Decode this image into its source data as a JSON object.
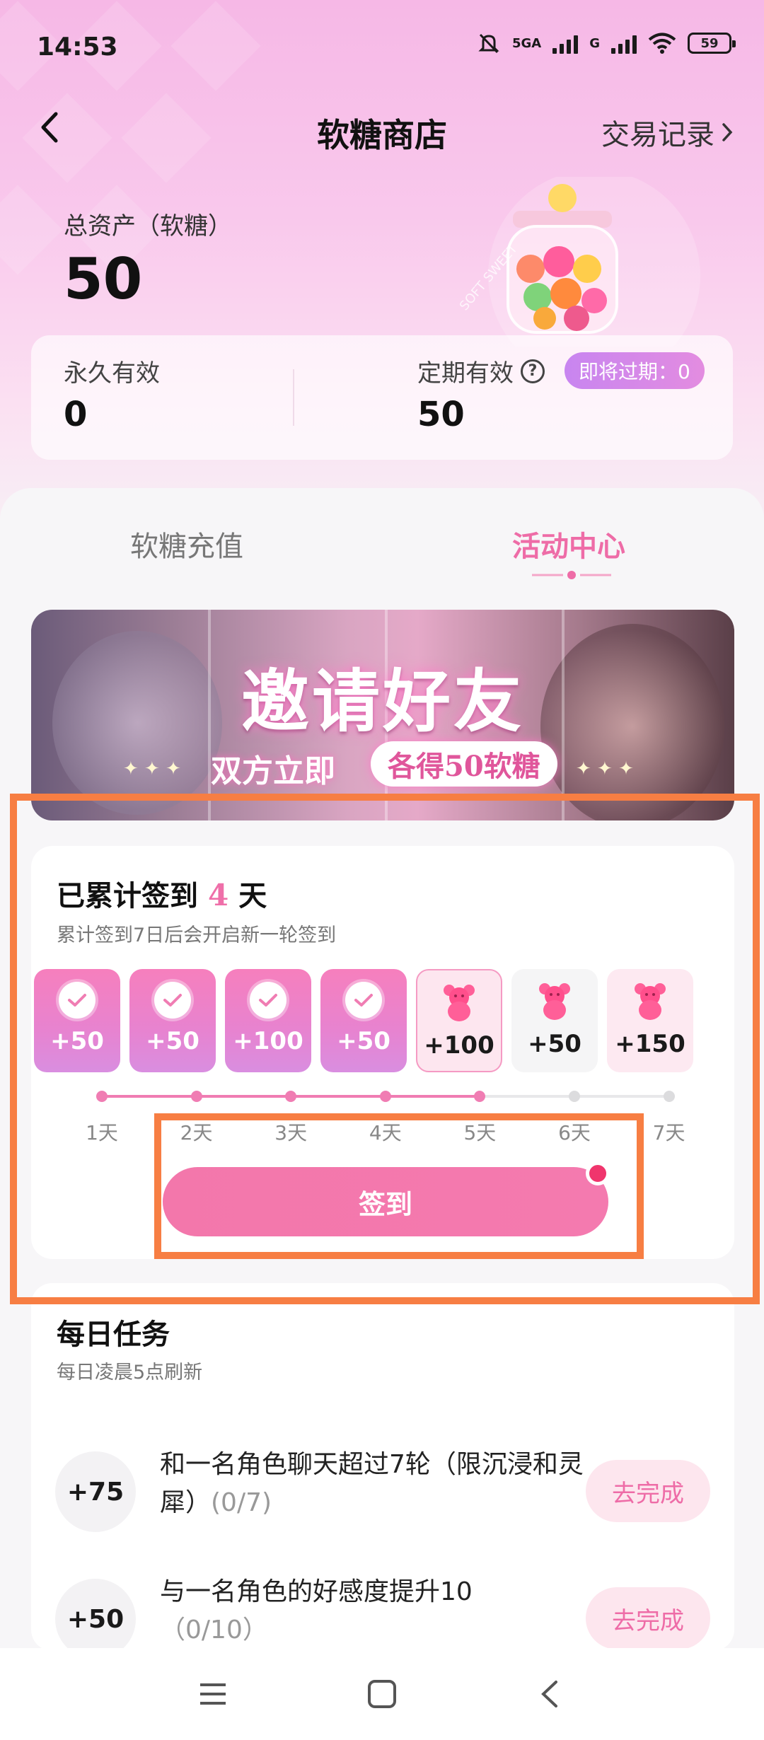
{
  "status_bar": {
    "time": "14:53",
    "network_1": "5GA",
    "network_2": "G",
    "battery": "59"
  },
  "header": {
    "title": "软糖商店",
    "trade_record": "交易记录"
  },
  "assets": {
    "total_label": "总资产（软糖）",
    "total_value": "50",
    "permanent_label": "永久有效",
    "permanent_value": "0",
    "term_label": "定期有效",
    "expire_badge": "即将过期：0",
    "term_value": "50"
  },
  "jar_text": "SOFT SWEET",
  "tabs": [
    {
      "label": "软糖充值",
      "active": false
    },
    {
      "label": "活动中心",
      "active": true
    }
  ],
  "banner": {
    "title": "邀请好友",
    "subtitle": "双方立即",
    "pill": "各得50软糖"
  },
  "checkin": {
    "title_prefix": "已累计签到",
    "days": "4",
    "title_suffix": "天",
    "subtitle": "累计签到7日后会开启新一轮签到",
    "button_label": "签到",
    "progress_days_done": 5,
    "days_list": [
      {
        "label": "1天",
        "amount": "+50",
        "state": "done"
      },
      {
        "label": "2天",
        "amount": "+50",
        "state": "done"
      },
      {
        "label": "3天",
        "amount": "+100",
        "state": "done"
      },
      {
        "label": "4天",
        "amount": "+50",
        "state": "done"
      },
      {
        "label": "5天",
        "amount": "+100",
        "state": "today"
      },
      {
        "label": "6天",
        "amount": "+50",
        "state": "future"
      },
      {
        "label": "7天",
        "amount": "+150",
        "state": "future-pink"
      }
    ]
  },
  "tasks": {
    "title": "每日任务",
    "subtitle": "每日凌晨5点刷新",
    "items": [
      {
        "reward": "+75",
        "text": "和一名角色聊天超过7轮（限沉浸和灵犀）",
        "count": "(0/7)",
        "button": "去完成"
      },
      {
        "reward": "+50",
        "text": "与一名角色的好感度提升10",
        "count": "（0/10）",
        "button": "去完成"
      }
    ]
  },
  "colors": {
    "accent": "#ee6ca7",
    "highlight_frame": "#f77e43",
    "button": "#f377ab"
  }
}
